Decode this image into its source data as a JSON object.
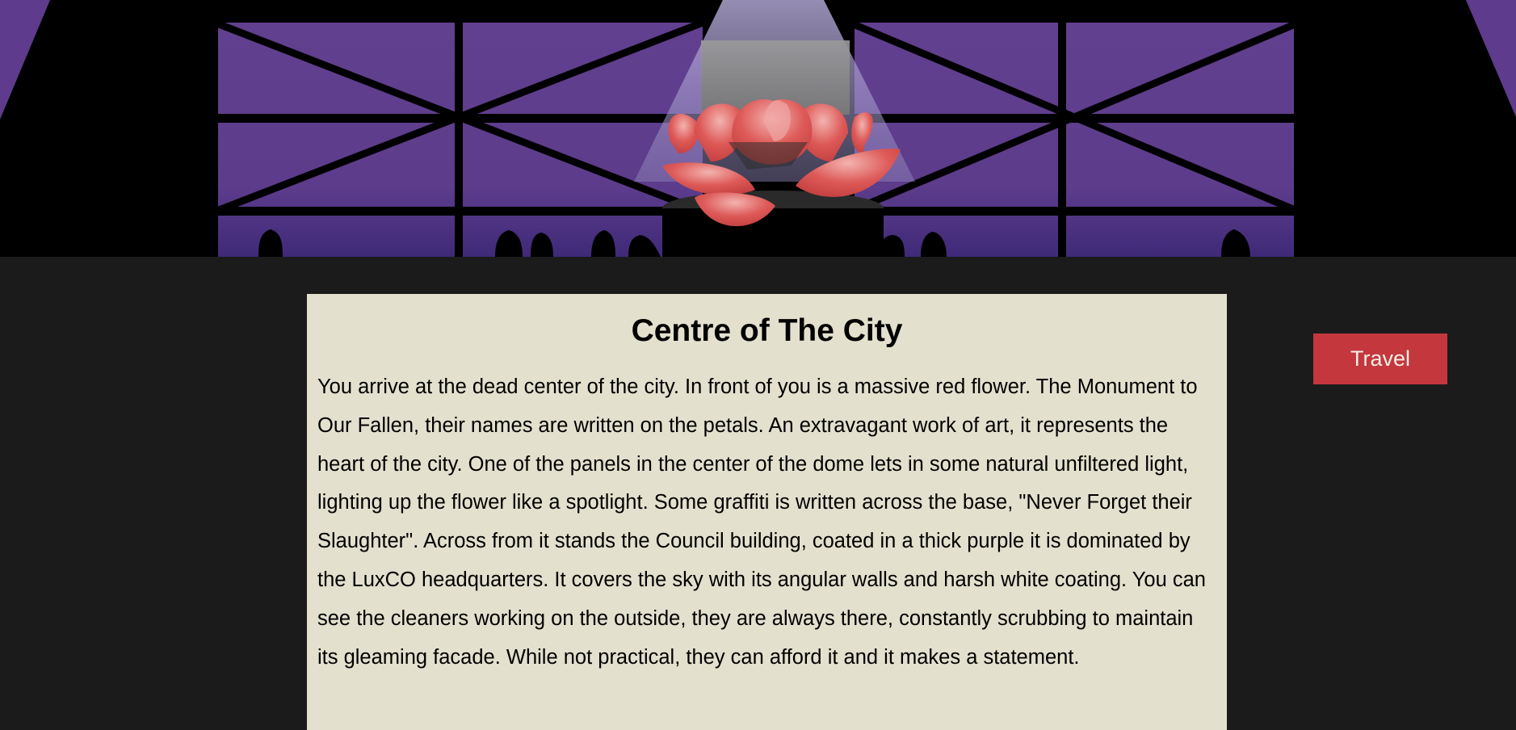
{
  "location": {
    "title": "Centre of The City",
    "description": "You arrive at the dead center of the city. In front of you is a massive red flower. The Monument to Our Fallen, their names are written on the petals. An extravagant work of art, it represents the heart of the city. One of the panels in the center of the dome lets in some natural unfiltered light, lighting up the flower like a spotlight. Some graffiti is written across the base, \"Never Forget their Slaughter\". Across from it stands the Council building, coated in a thick purple it is dominated by the LuxCO headquarters. It covers the sky with its angular walls and harsh white coating. You can see the cleaners working on the outside, they are always there, constantly scrubbing to maintain its gleaming facade. While not practical, they can afford it and it makes a statement."
  },
  "actions": {
    "travel_label": "Travel"
  },
  "colors": {
    "page_background": "#1b1b1b",
    "panel_background": "#e3e0ce",
    "travel_button": "#c3373d",
    "dome_purple": "#5e3b8c",
    "flower_red": "#d9474a"
  },
  "scene": {
    "icons": [
      "purple-dome-window-icon",
      "red-flower-monument-icon",
      "spotlight-beam-icon",
      "crowd-silhouette-icon"
    ]
  }
}
